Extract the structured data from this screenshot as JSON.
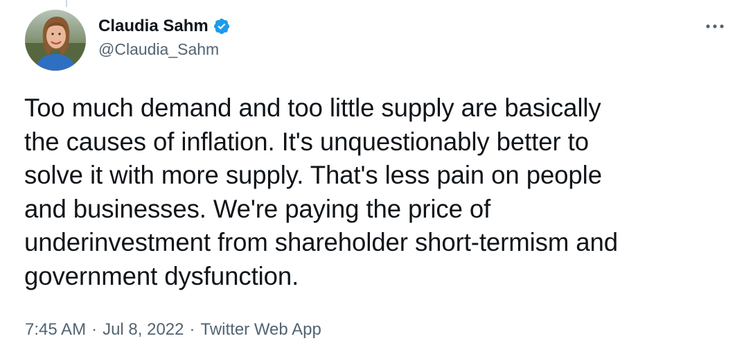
{
  "author": {
    "display_name": "Claudia Sahm",
    "handle": "@Claudia_Sahm",
    "verified": true,
    "avatar_icon": "profile-photo"
  },
  "tweet": {
    "text": "Too much demand and too little supply are basically\nthe causes of inflation. It's unquestionably better to\nsolve it with more supply. That's less pain on people\nand businesses. We're paying the price of\nunderinvestment from shareholder short-termism and\ngovernment dysfunction.",
    "time": "7:45 AM",
    "separator": "·",
    "date": "Jul 8, 2022",
    "source": "Twitter Web App"
  },
  "icons": {
    "more": "more-options-icon",
    "verified": "verified-badge-icon"
  },
  "colors": {
    "verified_blue": "#1d9bf0",
    "secondary_text": "#536471",
    "primary_text": "#0f1419"
  }
}
